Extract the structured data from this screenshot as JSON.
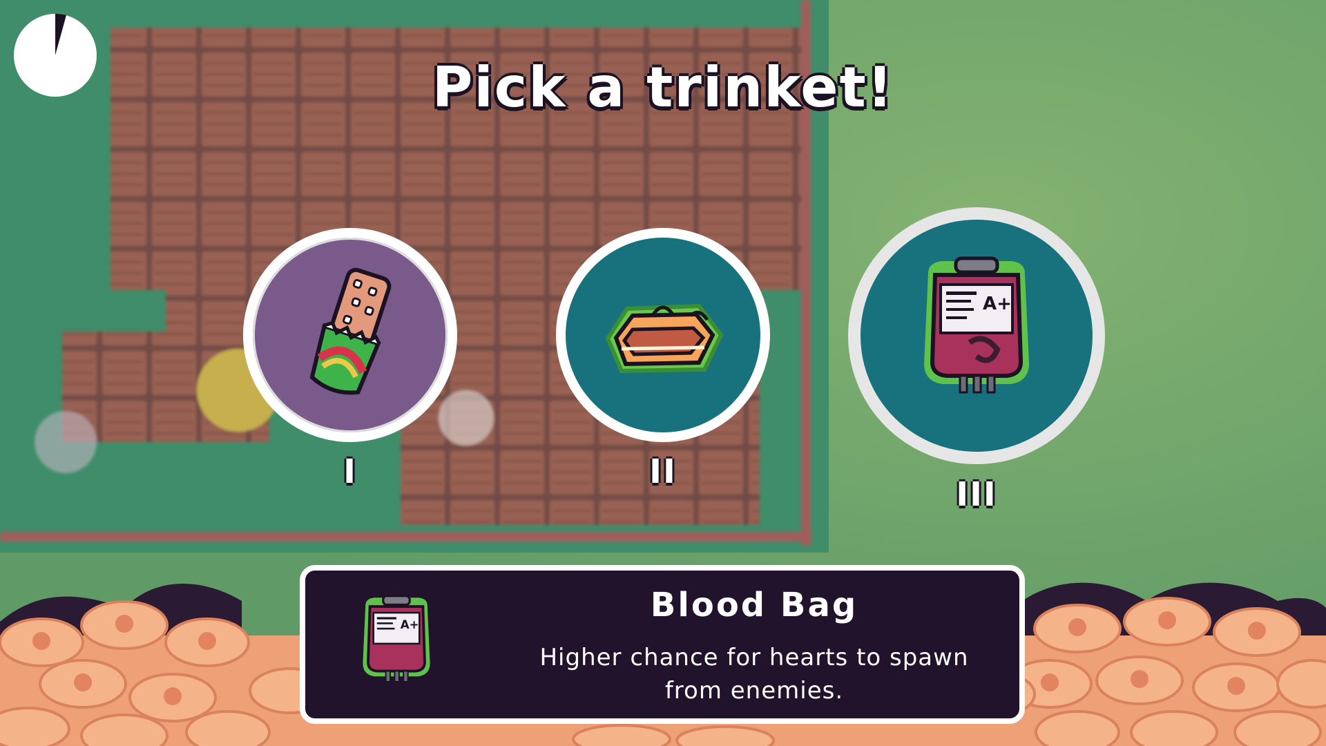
{
  "screen": {
    "title": "Pick a trinket!"
  },
  "trinkets": [
    {
      "numeral": "I",
      "icon": "candy-bar-icon",
      "background": "#7a5a8a"
    },
    {
      "numeral": "II",
      "icon": "inflatable-raft-icon",
      "background": "#17727e"
    },
    {
      "numeral": "III",
      "icon": "blood-bag-icon",
      "background": "#17727e",
      "selected": true
    }
  ],
  "selected_trinket": {
    "name": "Blood Bag",
    "description": "Higher chance for hearts to spawn from enemies.",
    "icon": "blood-bag-icon",
    "label": "A+"
  },
  "hud": {
    "timer_icon": "timer-pie-icon"
  },
  "colors": {
    "panel_bg": "#22132d",
    "outline": "#1b1324",
    "grass": "#4f8a62",
    "brick": "#a2584f",
    "coin": "#f2a878"
  }
}
